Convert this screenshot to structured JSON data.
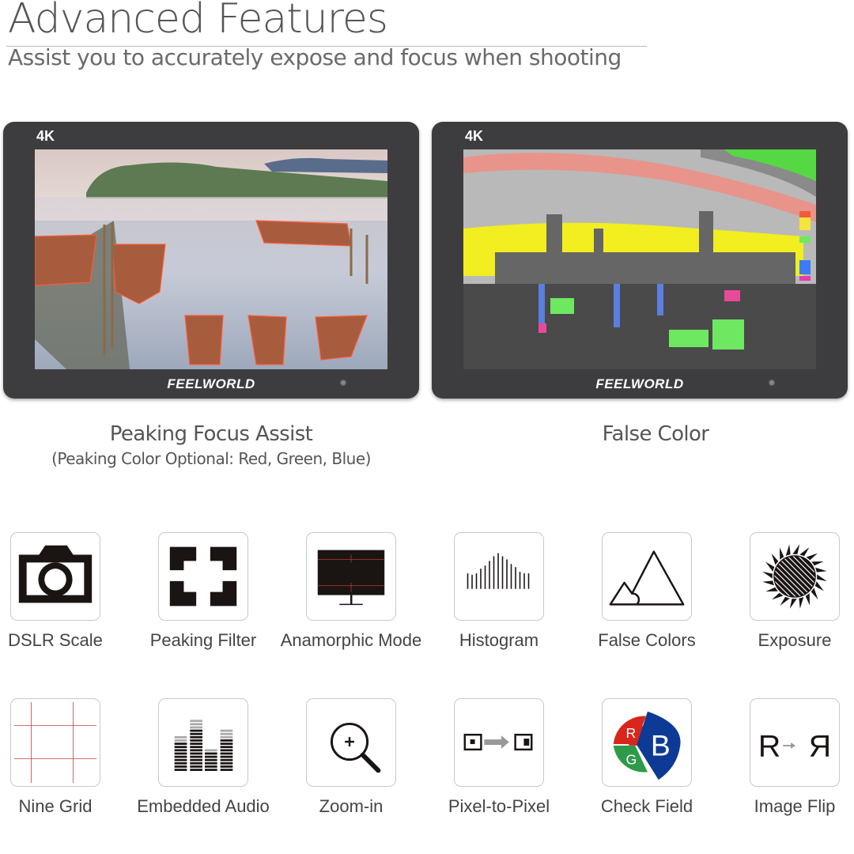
{
  "header": {
    "title": "Advanced Features",
    "subtitle": "Assist you to accurately expose and focus when shooting"
  },
  "monitors": [
    {
      "badge": "4K",
      "brand": "FEELWORLD",
      "screen_content": "Lake scene with boats and pier shown with peaking highlights",
      "caption": "Peaking Focus Assist",
      "sub_caption": "(Peaking Color Optional: Red, Green, Blue)"
    },
    {
      "badge": "4K",
      "brand": "FEELWORLD",
      "screen_content": "London skyline with Big Ben shown in false color overlay",
      "caption": "False Color",
      "sub_caption": ""
    }
  ],
  "features": [
    {
      "label": "DSLR Scale",
      "icon": "camera-icon"
    },
    {
      "label": "Peaking Filter",
      "icon": "focus-brackets-icon"
    },
    {
      "label": "Anamorphic Mode",
      "icon": "monitor-icon"
    },
    {
      "label": "Histogram",
      "icon": "histogram-icon"
    },
    {
      "label": "False Colors",
      "icon": "mountains-icon"
    },
    {
      "label": "Exposure",
      "icon": "sun-icon"
    },
    {
      "label": "Nine Grid",
      "icon": "grid-icon"
    },
    {
      "label": "Embedded Audio",
      "icon": "audio-meter-icon"
    },
    {
      "label": "Zoom-in",
      "icon": "magnifier-icon"
    },
    {
      "label": "Pixel-to-Pixel",
      "icon": "pixel-arrow-icon"
    },
    {
      "label": "Check Field",
      "icon": "rgb-check-icon",
      "letters": [
        "R",
        "G",
        "B"
      ]
    },
    {
      "label": "Image Flip",
      "icon": "flip-r-icon",
      "letters": [
        "R",
        "R"
      ]
    }
  ],
  "colors": {
    "bezel": "#3d3d3f",
    "text": "#444444",
    "grid_red": "#c0392b",
    "check_red": "#d9261c",
    "check_green": "#2e9a4a",
    "check_blue": "#0d3a94"
  }
}
